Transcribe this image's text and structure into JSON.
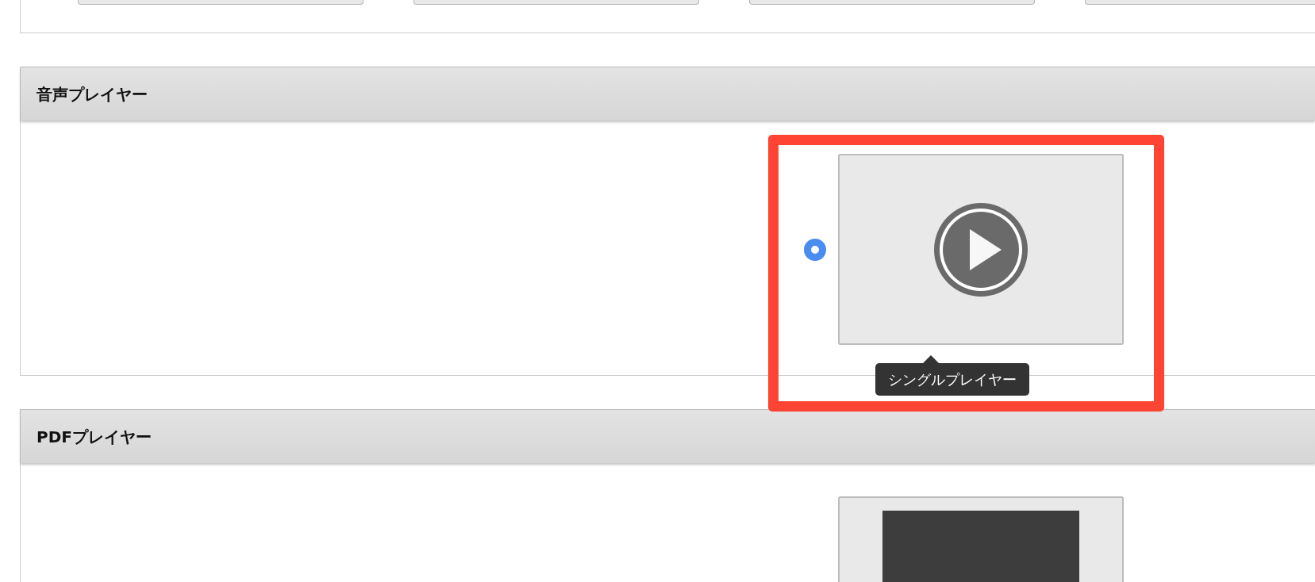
{
  "previous_section": {
    "items": [
      {
        "kind": "thumbnail"
      },
      {
        "kind": "thumbnail"
      },
      {
        "kind": "thumbnail"
      },
      {
        "kind": "thumbnail"
      }
    ]
  },
  "sections": [
    {
      "title": "音声プレイヤー",
      "options": [
        {
          "kind": "audio",
          "selected": true,
          "highlighted": true,
          "tooltip": "シングルプレイヤー"
        }
      ]
    },
    {
      "title": "PDFプレイヤー",
      "options": [
        {
          "kind": "pdf"
        }
      ]
    }
  ]
}
